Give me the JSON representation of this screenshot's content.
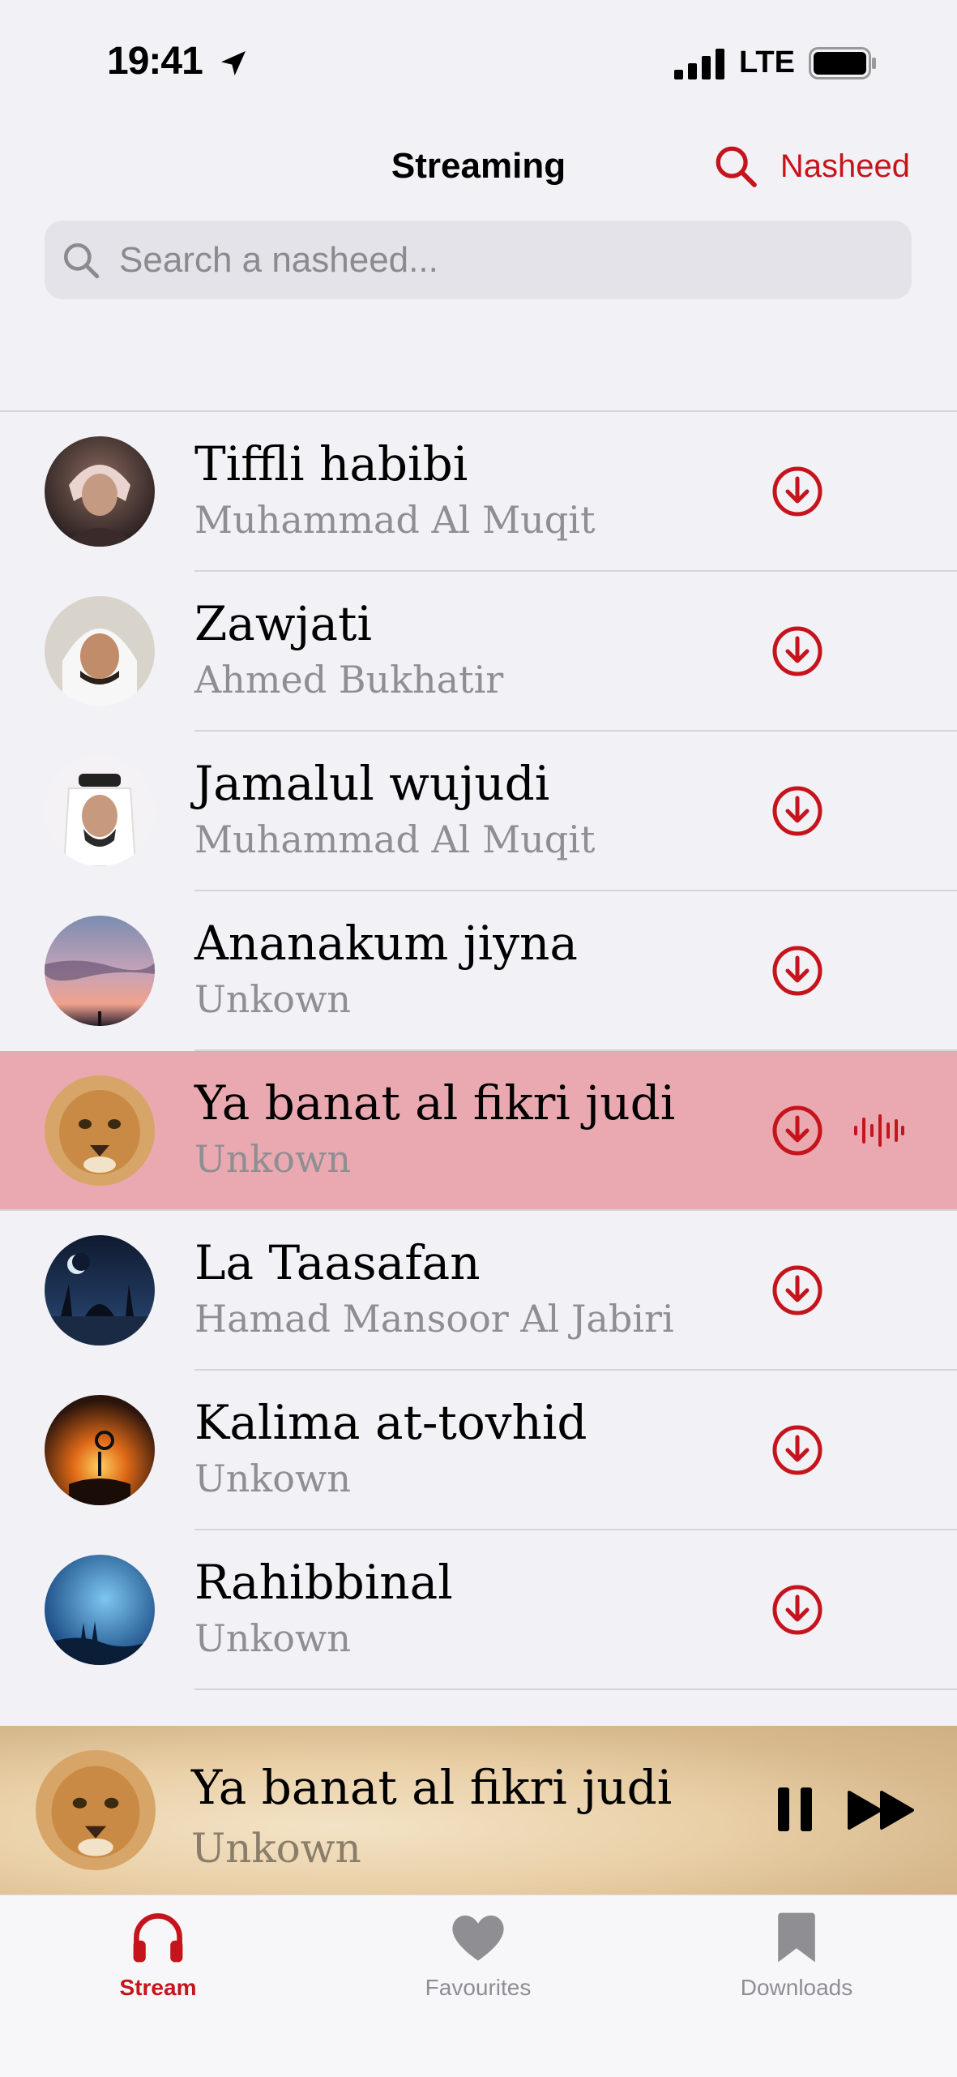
{
  "status_bar": {
    "time": "19:41",
    "network": "LTE"
  },
  "header": {
    "title": "Streaming",
    "action_label": "Nasheed"
  },
  "search": {
    "placeholder": "Search a nasheed..."
  },
  "tracks": [
    {
      "title": "Tiffli habibi",
      "artist": "Muhammad Al Muqit"
    },
    {
      "title": "Zawjati",
      "artist": "Ahmed Bukhatir"
    },
    {
      "title": "Jamalul wujudi",
      "artist": "Muhammad Al Muqit"
    },
    {
      "title": "Ananakum jiyna",
      "artist": "Unkown"
    },
    {
      "title": "Ya banat al fikri judi",
      "artist": "Unkown",
      "playing": true
    },
    {
      "title": "La Taasafan",
      "artist": "Hamad Mansoor Al Jabiri"
    },
    {
      "title": "Kalima at-tovhid",
      "artist": "Unkown"
    },
    {
      "title": "Rahibbinal",
      "artist": "Unkown"
    }
  ],
  "now_playing": {
    "title": "Ya banat al fikri judi",
    "artist": "Unkown"
  },
  "tabs": [
    {
      "label": "Stream",
      "icon": "headphones-icon",
      "selected": true
    },
    {
      "label": "Favourites",
      "icon": "heart-icon"
    },
    {
      "label": "Downloads",
      "icon": "bookmark-icon"
    }
  ],
  "colors": {
    "accent": "#c6141c",
    "active_row": "#eaa9b0",
    "background": "#f2f1f6"
  }
}
